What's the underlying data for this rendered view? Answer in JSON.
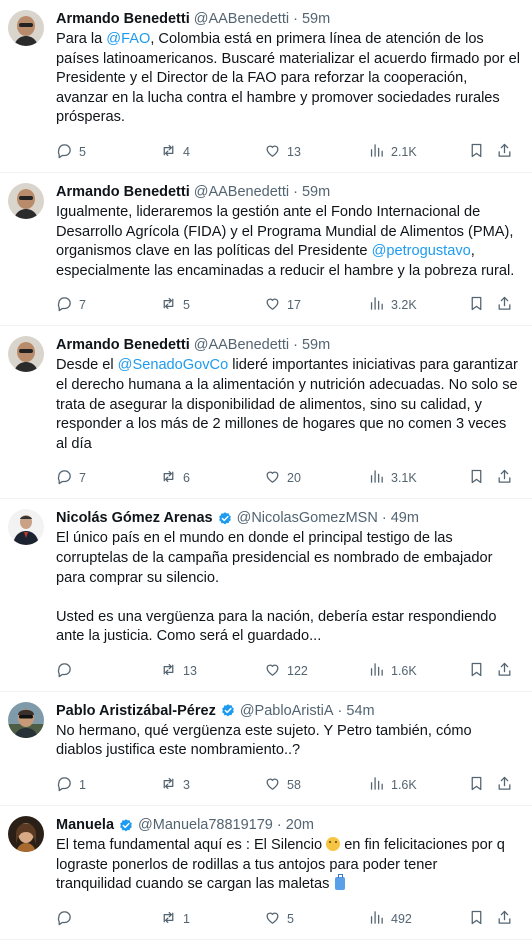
{
  "tweets": [
    {
      "name": "Armando Benedetti",
      "handle": "@AABenedetti",
      "dot": "·",
      "time": "59m",
      "verified": false,
      "segments": [
        {
          "t": "Para la "
        },
        {
          "t": "@FAO",
          "m": true
        },
        {
          "t": ", Colombia está en primera línea de atención de los países latinoamericanos. Buscaré materializar el acuerdo firmado por el Presidente y el Director de la FAO para reforzar la cooperación, avanzar en la lucha contra el hambre y promover sociedades rurales prósperas."
        }
      ],
      "replies": "5",
      "reposts": "4",
      "likes": "13",
      "views": "2.1K"
    },
    {
      "name": "Armando Benedetti",
      "handle": "@AABenedetti",
      "dot": "·",
      "time": "59m",
      "verified": false,
      "segments": [
        {
          "t": "Igualmente, lideraremos la gestión ante el Fondo Internacional de Desarrollo Agrícola (FIDA) y el Programa Mundial de Alimentos (PMA), organismos clave en las políticas del Presidente "
        },
        {
          "t": "@petrogustavo",
          "m": true
        },
        {
          "t": ", especialmente las encaminadas a reducir el hambre y la pobreza rural."
        }
      ],
      "replies": "7",
      "reposts": "5",
      "likes": "17",
      "views": "3.2K"
    },
    {
      "name": "Armando Benedetti",
      "handle": "@AABenedetti",
      "dot": "·",
      "time": "59m",
      "verified": false,
      "segments": [
        {
          "t": "Desde el "
        },
        {
          "t": "@SenadoGovCo",
          "m": true
        },
        {
          "t": " lideré importantes iniciativas para garantizar el derecho humana a la alimentación y nutrición adecuadas. No solo se trata de asegurar la disponibilidad de alimentos, sino su calidad, y responder a los más de 2 millones de hogares que no comen 3 veces al día"
        }
      ],
      "replies": "7",
      "reposts": "6",
      "likes": "20",
      "views": "3.1K"
    },
    {
      "name": "Nicolás Gómez Arenas",
      "handle": "@NicolasGomezMSN",
      "dot": "·",
      "time": "49m",
      "verified": true,
      "segments": [
        {
          "t": "El único país en el mundo en donde el principal testigo de las corruptelas de la campaña presidencial es nombrado de embajador para comprar su silencio.\n\nUsted es una vergüenza para la nación, debería estar respondiendo ante la justicia. Como será el guardado..."
        }
      ],
      "replies": "",
      "reposts": "13",
      "likes": "122",
      "views": "1.6K"
    },
    {
      "name": "Pablo Aristizábal-Pérez",
      "handle": "@PabloAristiA",
      "dot": "·",
      "time": "54m",
      "verified": true,
      "segments": [
        {
          "t": "No hermano, qué vergüenza este sujeto. Y Petro también, cómo diablos justifica este nombramiento..?"
        }
      ],
      "replies": "1",
      "reposts": "3",
      "likes": "58",
      "views": "1.6K"
    },
    {
      "name": "Manuela",
      "handle": "@Manuela78819179",
      "dot": "·",
      "time": "20m",
      "verified": true,
      "segments": [
        {
          "t": "El tema fundamental aquí es : El Silencio "
        },
        {
          "t": "",
          "emoji": "no-mouth"
        },
        {
          "t": " en fin felicitaciones por q lograste ponerlos de rodillas a tus antojos para poder tener  tranquilidad cuando se cargan las maletas "
        },
        {
          "t": "",
          "emoji": "luggage"
        }
      ],
      "replies": "",
      "reposts": "1",
      "likes": "5",
      "views": "492"
    }
  ],
  "colors": {
    "accent": "#1d9bf0",
    "muted": "#536471",
    "text": "#0f1419"
  },
  "icons": {
    "reply": "reply-icon",
    "repost": "repost-icon",
    "like": "like-icon",
    "views": "views-icon",
    "bookmark": "bookmark-icon",
    "share": "share-icon",
    "verified": "verified-badge-icon"
  }
}
